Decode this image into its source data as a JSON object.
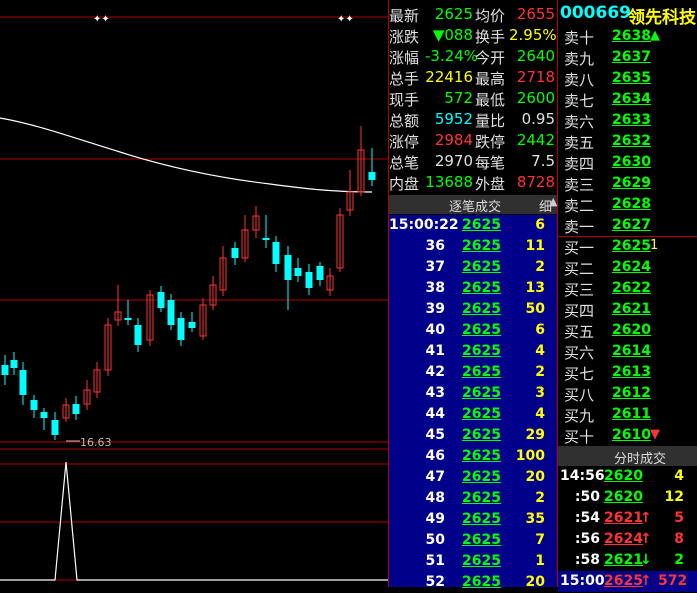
{
  "colors": {
    "up": "#ff3333",
    "down": "#00ff00",
    "flat": "#ffffff",
    "vol": "#ffff00",
    "label": "#e0e0e0",
    "accent": "#00ffff",
    "grid": "#b00000",
    "ticks_bg": "#00008a"
  },
  "chart": {
    "markers": [
      "✦✦",
      "✦✦"
    ],
    "low_label": "16.63"
  },
  "quote": {
    "rows": [
      {
        "l1": "最新",
        "v1": "2625",
        "c1": "#00ff00",
        "l2": "均价",
        "v2": "2655",
        "c2": "#ff3333"
      },
      {
        "l1": "涨跌",
        "v1": "▼088",
        "c1": "#00ff00",
        "l2": "换手",
        "v2": "2.95%",
        "c2": "#ffff00"
      },
      {
        "l1": "涨幅",
        "v1": "-3.24%",
        "c1": "#00ff00",
        "l2": "今开",
        "v2": "2640",
        "c2": "#00ff00"
      },
      {
        "l1": "总手",
        "v1": "22416",
        "c1": "#ffff00",
        "l2": "最高",
        "v2": "2718",
        "c2": "#ff3333"
      },
      {
        "l1": "现手",
        "v1": "572",
        "c1": "#00ff00",
        "l2": "最低",
        "v2": "2600",
        "c2": "#00ff00"
      },
      {
        "l1": "总额",
        "v1": "5952",
        "c1": "#00ffff",
        "l2": "量比",
        "v2": "0.95",
        "c2": "#e0e0e0"
      },
      {
        "l1": "涨停",
        "v1": "2984",
        "c1": "#ff3333",
        "l2": "跌停",
        "v2": "2442",
        "c2": "#00ff00"
      },
      {
        "l1": "总笔",
        "v1": "2970",
        "c1": "#e0e0e0",
        "l2": "每笔",
        "v2": "7.5",
        "c2": "#e0e0e0"
      },
      {
        "l1": "内盘",
        "v1": "13688",
        "c1": "#00ff00",
        "l2": "外盘",
        "v2": "8728",
        "c2": "#ff3333"
      }
    ]
  },
  "ticks": {
    "title": "逐笔成交",
    "tab": "细",
    "rows": [
      {
        "t": "15:00:22",
        "p": "2625",
        "v": "6"
      },
      {
        "t": "36",
        "p": "2625",
        "v": "11"
      },
      {
        "t": "37",
        "p": "2625",
        "v": "2"
      },
      {
        "t": "38",
        "p": "2625",
        "v": "13"
      },
      {
        "t": "39",
        "p": "2625",
        "v": "50"
      },
      {
        "t": "40",
        "p": "2625",
        "v": "6"
      },
      {
        "t": "41",
        "p": "2625",
        "v": "4"
      },
      {
        "t": "42",
        "p": "2625",
        "v": "2"
      },
      {
        "t": "43",
        "p": "2625",
        "v": "3"
      },
      {
        "t": "44",
        "p": "2625",
        "v": "4"
      },
      {
        "t": "45",
        "p": "2625",
        "v": "29"
      },
      {
        "t": "46",
        "p": "2625",
        "v": "100"
      },
      {
        "t": "47",
        "p": "2625",
        "v": "20"
      },
      {
        "t": "48",
        "p": "2625",
        "v": "2"
      },
      {
        "t": "49",
        "p": "2625",
        "v": "35"
      },
      {
        "t": "50",
        "p": "2625",
        "v": "7"
      },
      {
        "t": "51",
        "p": "2625",
        "v": "1"
      },
      {
        "t": "52",
        "p": "2625",
        "v": "20"
      }
    ]
  },
  "book": {
    "code": "000669",
    "name": "领先科技",
    "sells": [
      {
        "l": "卖十",
        "p": "2638",
        "a": "▲"
      },
      {
        "l": "卖九",
        "p": "2637",
        "a": ""
      },
      {
        "l": "卖八",
        "p": "2635",
        "a": ""
      },
      {
        "l": "卖七",
        "p": "2634",
        "a": ""
      },
      {
        "l": "卖六",
        "p": "2633",
        "a": ""
      },
      {
        "l": "卖五",
        "p": "2632",
        "a": ""
      },
      {
        "l": "卖四",
        "p": "2630",
        "a": ""
      },
      {
        "l": "卖三",
        "p": "2629",
        "a": ""
      },
      {
        "l": "卖二",
        "p": "2628",
        "a": ""
      },
      {
        "l": "卖一",
        "p": "2627",
        "a": ""
      }
    ],
    "buys": [
      {
        "l": "买一",
        "p": "2625",
        "a": "1"
      },
      {
        "l": "买二",
        "p": "2624",
        "a": ""
      },
      {
        "l": "买三",
        "p": "2622",
        "a": ""
      },
      {
        "l": "买四",
        "p": "2621",
        "a": ""
      },
      {
        "l": "买五",
        "p": "2620",
        "a": ""
      },
      {
        "l": "买六",
        "p": "2614",
        "a": ""
      },
      {
        "l": "买七",
        "p": "2613",
        "a": ""
      },
      {
        "l": "买八",
        "p": "2612",
        "a": ""
      },
      {
        "l": "买九",
        "p": "2611",
        "a": ""
      },
      {
        "l": "买十",
        "p": "2610",
        "a": "▼"
      }
    ]
  },
  "minute": {
    "title": "分时成交",
    "rows": [
      {
        "t": "14:56",
        "p": "2620",
        "a": "",
        "v": "4",
        "vc": "#ffff00"
      },
      {
        "t": ":50",
        "p": "2620",
        "a": "",
        "v": "12",
        "vc": "#ffff00"
      },
      {
        "t": ":54",
        "p": "2621",
        "a": "↑",
        "ac": "#ff3333",
        "v": "5",
        "vc": "#ff3333"
      },
      {
        "t": ":56",
        "p": "2624",
        "a": "↑",
        "ac": "#ff3333",
        "v": "8",
        "vc": "#ff3333"
      },
      {
        "t": ":58",
        "p": "2621",
        "a": "↓",
        "ac": "#00ff00",
        "v": "2",
        "vc": "#00ff00"
      },
      {
        "t": "15:00",
        "p": "2625",
        "a": "↑",
        "ac": "#ff3333",
        "v": "572",
        "vc": "#ff3333"
      }
    ]
  }
}
